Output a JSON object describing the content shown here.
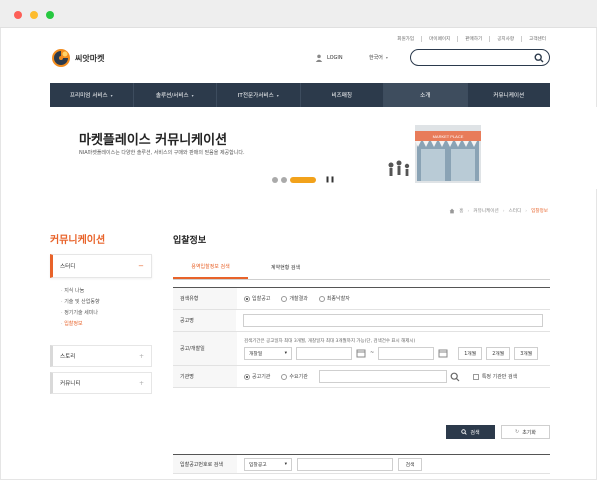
{
  "utility_links": [
    "회원가입",
    "마이페이지",
    "판매하기",
    "공지사항",
    "고객센터"
  ],
  "logo": {
    "text": "씨앗마켓"
  },
  "header": {
    "login_label": "LOGIN",
    "lang_label": "한국어"
  },
  "gnb": [
    {
      "label": "프리미엄 서비스",
      "caret": "▾"
    },
    {
      "label": "솔루션/서비스",
      "caret": "▾"
    },
    {
      "label": "IT전문가서비스",
      "caret": "▾"
    },
    {
      "label": "비즈매칭",
      "caret": ""
    },
    {
      "label": "소개",
      "caret": ""
    },
    {
      "label": "커뮤니케이션",
      "caret": ""
    }
  ],
  "banner": {
    "title": "마켓플레이스 커뮤니케이션",
    "desc": "NIA마켓플레이스는 다양한 솔루션, 서비스의 구매와 판매의 믿음을 제공합니다.",
    "store_sign": "MARKET PLACE",
    "pause": "❚❚"
  },
  "breadcrumb": [
    "홈",
    "커뮤니케이션",
    "스터디",
    "입찰정보"
  ],
  "sidebar": {
    "title": "커뮤니케이션",
    "active": {
      "label": "스터디",
      "toggle": "−"
    },
    "sub_items": [
      "지식 나눔",
      "기술 및 산업동향",
      "정기기술 세미나",
      "입찰정보"
    ],
    "items": [
      {
        "label": "스토리",
        "toggle": "+"
      },
      {
        "label": "커뮤니티",
        "toggle": "+"
      }
    ]
  },
  "content": {
    "title": "입찰정보",
    "tabs": [
      "용역입찰정보 검색",
      "계약현황 검색"
    ],
    "form": {
      "type_label": "검색유형",
      "type_options": [
        "입찰공고",
        "개찰결과",
        "최종낙찰자"
      ],
      "notice_label": "공고명",
      "date_label": "공고/개찰일",
      "date_note": "검색기간은 공고일자 최대 3개월, 개찰일자 최대 3개월까지 가능(단, 검색건수 표시 해제시)",
      "date_select": "개찰일",
      "date_sep": "~",
      "period_buttons": [
        "1개월",
        "2개월",
        "3개월"
      ],
      "agency_label": "기관명",
      "agency_options": [
        "공고기관",
        "수요기관"
      ],
      "specific_agency": "특정 기관만 검색"
    },
    "search_button": "검색",
    "reset_button": "초기화",
    "number_search": {
      "label": "입찰공고번호로 검색",
      "select": "입찰공고",
      "button": "검색"
    }
  }
}
